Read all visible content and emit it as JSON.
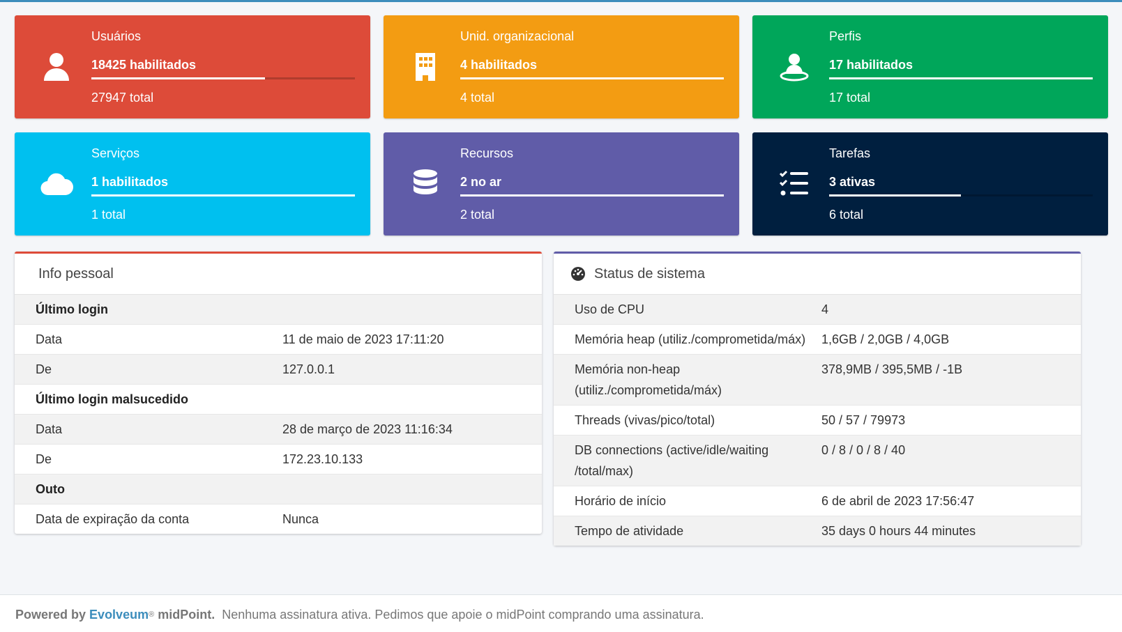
{
  "infoboxes": [
    {
      "title": "Usuários",
      "count": "18425 habilitados",
      "total": "27947 total",
      "color": "#dd4b39",
      "icon": "user-icon",
      "progress": 0.66
    },
    {
      "title": "Unid. organizacional",
      "count": "4 habilitados",
      "total": "4 total",
      "color": "#f39c12",
      "icon": "building-icon",
      "progress": 1.0
    },
    {
      "title": "Perfis",
      "count": "17 habilitados",
      "total": "17 total",
      "color": "#00a65a",
      "icon": "role-icon",
      "progress": 1.0
    },
    {
      "title": "Serviços",
      "count": "1 habilitados",
      "total": "1 total",
      "color": "#00c0ef",
      "icon": "cloud-icon",
      "progress": 1.0
    },
    {
      "title": "Recursos",
      "count": "2 no ar",
      "total": "2 total",
      "color": "#605ca8",
      "icon": "database-icon",
      "progress": 1.0
    },
    {
      "title": "Tarefas",
      "count": "3 ativas",
      "total": "6 total",
      "color": "#001f3f",
      "icon": "task-list-icon",
      "progress": 0.5
    }
  ],
  "personal_info": {
    "title": "Info pessoal",
    "accent": "#dd4b39",
    "rows": [
      {
        "key": "Último login",
        "value": "",
        "section": true
      },
      {
        "key": "Data",
        "value": "11 de maio de 2023 17:11:20"
      },
      {
        "key": "De",
        "value": "127.0.0.1"
      },
      {
        "key": "Último login malsucedido",
        "value": "",
        "section": true
      },
      {
        "key": "Data",
        "value": "28 de março de 2023 11:16:34"
      },
      {
        "key": "De",
        "value": "172.23.10.133"
      },
      {
        "key": "Outo",
        "value": "",
        "section": true
      },
      {
        "key": "Data de expiração da conta",
        "value": "Nunca"
      }
    ]
  },
  "system_status": {
    "title": "Status de sistema",
    "accent": "#605ca8",
    "icon": "dashboard-gauge-icon",
    "rows": [
      {
        "key": "Uso de CPU",
        "value": "4"
      },
      {
        "key": "Memória heap (utiliz./comprometida/máx)",
        "value": "1,6GB / 2,0GB / 4,0GB"
      },
      {
        "key": "Memória non-heap (utiliz./comprometida/máx)",
        "value": "378,9MB / 395,5MB / -1B"
      },
      {
        "key": "Threads (vivas/pico/total)",
        "value": "50 / 57 / 79973"
      },
      {
        "key": "DB connections (active/idle/waiting /total/max)",
        "value": "0 / 8 / 0 / 8 / 40"
      },
      {
        "key": "Horário de início",
        "value": "6 de abril de 2023 17:56:47"
      },
      {
        "key": "Tempo de atividade",
        "value": "35 days 0 hours 44 minutes"
      }
    ]
  },
  "footer": {
    "powered_by": "Powered by",
    "brand": "Evolveum",
    "registered": "®",
    "product": "midPoint.",
    "message": "Nenhuma assinatura ativa. Pedimos que apoie o midPoint comprando uma assinatura."
  }
}
